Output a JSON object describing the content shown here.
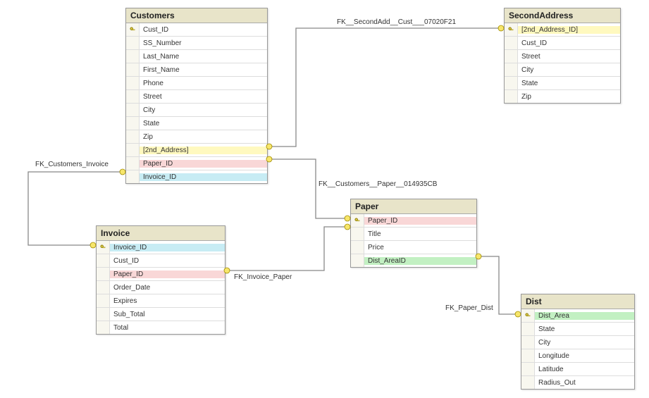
{
  "tables": {
    "customers": {
      "title": "Customers",
      "cols": [
        {
          "name": "Cust_ID",
          "pk": true
        },
        {
          "name": "SS_Number"
        },
        {
          "name": "Last_Name"
        },
        {
          "name": "First_Name"
        },
        {
          "name": "Phone"
        },
        {
          "name": "Street"
        },
        {
          "name": "City"
        },
        {
          "name": "State"
        },
        {
          "name": "Zip"
        },
        {
          "name": "[2nd_Address]",
          "color": "yellow"
        },
        {
          "name": "Paper_ID",
          "color": "pink"
        },
        {
          "name": "Invoice_ID",
          "color": "cyan"
        }
      ]
    },
    "secondaddress": {
      "title": "SecondAddress",
      "cols": [
        {
          "name": "[2nd_Address_ID]",
          "pk": true,
          "color": "yellow"
        },
        {
          "name": "Cust_ID"
        },
        {
          "name": "Street"
        },
        {
          "name": "City"
        },
        {
          "name": "State"
        },
        {
          "name": "Zip"
        }
      ]
    },
    "invoice": {
      "title": "Invoice",
      "cols": [
        {
          "name": "Invoice_ID",
          "pk": true,
          "color": "cyan"
        },
        {
          "name": "Cust_ID"
        },
        {
          "name": "Paper_ID",
          "color": "pink"
        },
        {
          "name": "Order_Date"
        },
        {
          "name": "Expires"
        },
        {
          "name": "Sub_Total"
        },
        {
          "name": "Total"
        }
      ]
    },
    "paper": {
      "title": "Paper",
      "cols": [
        {
          "name": "Paper_ID",
          "pk": true,
          "color": "pink"
        },
        {
          "name": "Title"
        },
        {
          "name": "Price"
        },
        {
          "name": "Dist_AreaID",
          "color": "green"
        }
      ]
    },
    "dist": {
      "title": "Dist",
      "cols": [
        {
          "name": "Dist_Area",
          "pk": true,
          "color": "green"
        },
        {
          "name": "State"
        },
        {
          "name": "City"
        },
        {
          "name": "Longitude"
        },
        {
          "name": "Latitude"
        },
        {
          "name": "Radius_Out"
        }
      ]
    }
  },
  "fk_labels": {
    "cust_inv": "FK_Customers_Invoice",
    "cust_paper": "FK__Customers__Paper__014935CB",
    "secondadd": "FK__SecondAdd__Cust___07020F21",
    "inv_paper": "FK_Invoice_Paper",
    "paper_dist": "FK_Paper_Dist"
  }
}
